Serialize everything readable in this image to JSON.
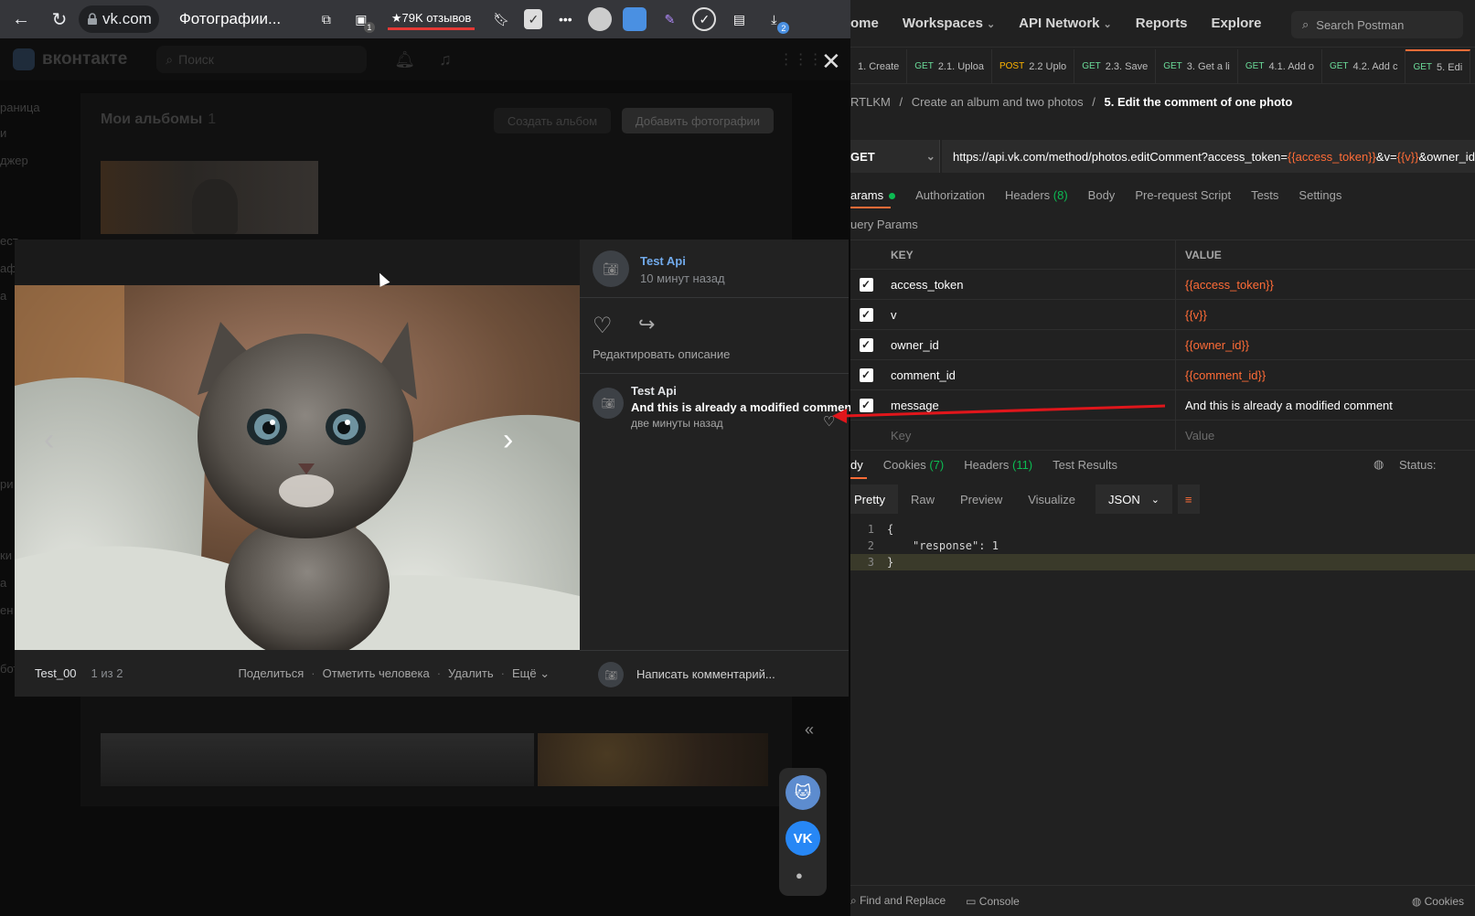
{
  "browser": {
    "url": "vk.com",
    "tab_title": "Фотографии...",
    "reviews_badge": "★79K отзывов",
    "download_count": "2",
    "ext_badge": "1"
  },
  "vk": {
    "logo": "вконтакте",
    "search_placeholder": "Поиск",
    "sidebar_items": [
      "раница",
      "и",
      "джер"
    ],
    "sidebar_fragments": [
      "ест",
      "аф",
      "а",
      "ри",
      "ки",
      "а",
      "ен",
      "бот"
    ],
    "albums_title": "Мои альбомы",
    "albums_count": "1",
    "create_album": "Создать альбом",
    "add_photos": "Добавить фотографии"
  },
  "viewer": {
    "author": "Test Api",
    "posted": "10 минут назад",
    "edit_description": "Редактировать описание",
    "comment": {
      "author": "Test Api",
      "text": "And this is already a modified comment",
      "time": "две минуты назад"
    },
    "album_name": "Test_00",
    "position": "1 из 2",
    "actions": [
      "Поделиться",
      "Отметить человека",
      "Удалить",
      "Ещё"
    ],
    "comment_placeholder": "Написать комментарий..."
  },
  "postman": {
    "nav": [
      "ome",
      "Workspaces",
      "API Network",
      "Reports",
      "Explore"
    ],
    "search": "Search Postman",
    "tabs": [
      {
        "method": "",
        "label": "1. Create"
      },
      {
        "method": "GET",
        "label": "2.1. Uploa"
      },
      {
        "method": "POST",
        "label": "2.2 Uplo"
      },
      {
        "method": "GET",
        "label": "2.3. Save"
      },
      {
        "method": "GET",
        "label": "3. Get a li"
      },
      {
        "method": "GET",
        "label": "4.1. Add o"
      },
      {
        "method": "GET",
        "label": "4.2. Add c"
      },
      {
        "method": "GET",
        "label": "5. Edi"
      }
    ],
    "breadcrumb": {
      "root": "RTLKM",
      "folder": "Create an album and two photos",
      "current": "5. Edit the comment of one photo"
    },
    "method": "GET",
    "url_parts": [
      {
        "t": "https://api.vk.com/method/photos.editComment?access_token=",
        "v": false
      },
      {
        "t": "{{access_token}}",
        "v": true
      },
      {
        "t": "&v=",
        "v": false
      },
      {
        "t": "{{v}}",
        "v": true
      },
      {
        "t": "&owner_id=",
        "v": false
      }
    ],
    "subtabs": [
      "arams",
      "Authorization",
      "Headers",
      "(8)",
      "Body",
      "Pre-request Script",
      "Tests",
      "Settings"
    ],
    "query_params_label": "uery Params",
    "col_key": "KEY",
    "col_value": "VALUE",
    "params": [
      {
        "key": "access_token",
        "value": "{{access_token}}",
        "var": true
      },
      {
        "key": "v",
        "value": "{{v}}",
        "var": true
      },
      {
        "key": "owner_id",
        "value": "{{owner_id}}",
        "var": true
      },
      {
        "key": "comment_id",
        "value": "{{comment_id}}",
        "var": true
      },
      {
        "key": "message",
        "value": "And this is already a modified comment",
        "var": false
      }
    ],
    "key_placeholder": "Key",
    "value_placeholder": "Value",
    "resp_tabs": [
      "dy",
      "Cookies",
      "(7)",
      "Headers",
      "(11)",
      "Test Results"
    ],
    "status_label": "Status:",
    "view_modes": [
      "Pretty",
      "Raw",
      "Preview",
      "Visualize"
    ],
    "format": "JSON",
    "code_lines": [
      "{",
      "\"response\": 1",
      "}"
    ],
    "line_numbers": [
      "1",
      "2",
      "3"
    ],
    "footer": [
      "Find and Replace",
      "Console",
      "Cookies"
    ]
  },
  "colors": {
    "accent_orange": "#ff6c37",
    "get_green": "#6bdd9a",
    "post_yellow": "#ffb400",
    "vk_blue": "#71aaeb",
    "arrow_red": "#e0161b"
  }
}
